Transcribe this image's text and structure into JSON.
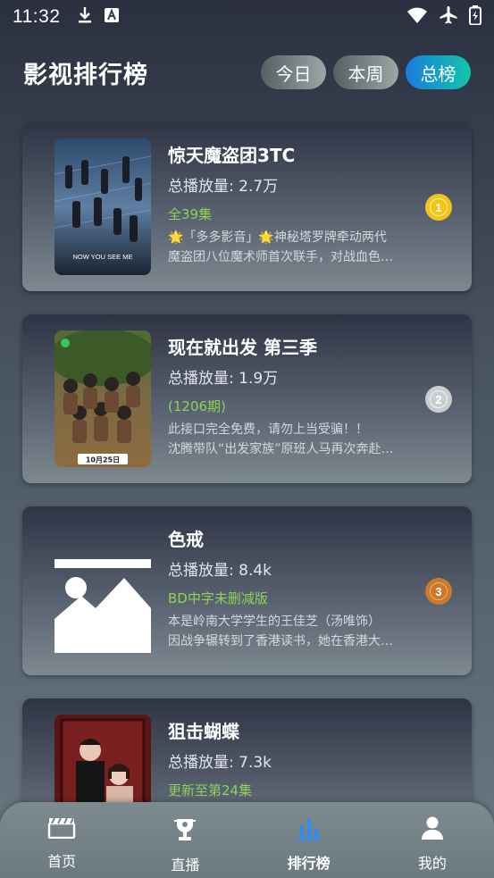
{
  "status_bar": {
    "time": "11:32"
  },
  "header": {
    "title": "影视排行榜",
    "tabs": [
      {
        "label": "今日",
        "active": false
      },
      {
        "label": "本周",
        "active": false
      },
      {
        "label": "总榜",
        "active": true
      }
    ]
  },
  "list": [
    {
      "title": "惊天魔盗团3TC",
      "plays": "总播放量: 2.7万",
      "episodes": "全39集",
      "desc_line1": "🌟「多多影音」🌟神秘塔罗牌牵动两代",
      "desc_line2": "魔盗团八位魔术师首次联手，对战血色…",
      "rank": "1",
      "rank_color": "#f5c418",
      "poster_caption": "NOW YOU SEE ME"
    },
    {
      "title": "现在就出发 第三季",
      "plays": "总播放量: 1.9万",
      "episodes": "(1206期)",
      "desc_line1": "此接口完全免费，请勿上当受骗！！",
      "desc_line2": "沈腾带队“出发家族”原班人马再次奔赴…",
      "rank": "2",
      "rank_color": "#c9cdd0",
      "poster_caption": "10月25日"
    },
    {
      "title": "色戒",
      "plays": "总播放量: 8.4k",
      "episodes": "BD中字未删减版",
      "desc_line1": "本是岭南大学学生的王佳芝（汤唯饰）",
      "desc_line2": "因战争辗转到了香港读书，她在香港大…",
      "rank": "3",
      "rank_color": "#c97a2a",
      "poster_caption": ""
    },
    {
      "title": "狙击蝴蝶",
      "plays": "总播放量: 7.3k",
      "episodes": "更新至第24集",
      "desc_line1": "",
      "desc_line2": "",
      "rank": "",
      "rank_color": "",
      "poster_caption": ""
    }
  ],
  "bottom_nav": [
    {
      "label": "首页",
      "icon": "clapperboard-icon",
      "active": false
    },
    {
      "label": "直播",
      "icon": "live-trophy-icon",
      "active": false
    },
    {
      "label": "排行榜",
      "icon": "bar-chart-icon",
      "active": true
    },
    {
      "label": "我的",
      "icon": "user-icon",
      "active": false
    }
  ],
  "colors": {
    "accent": "#2f8cf0",
    "episode_green": "#8fd255",
    "tab_active_start": "#1b7be0",
    "tab_active_end": "#10c6a8"
  }
}
